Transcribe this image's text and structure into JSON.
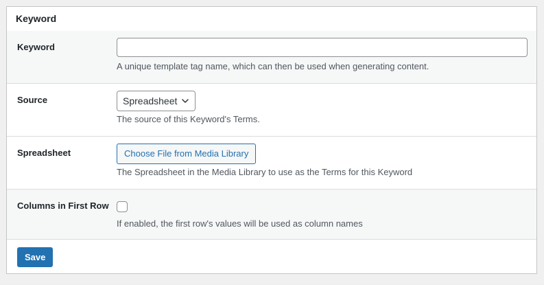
{
  "panel": {
    "title": "Keyword"
  },
  "fields": {
    "keyword": {
      "label": "Keyword",
      "value": "",
      "placeholder": "",
      "description": "A unique template tag name, which can then be used when generating content."
    },
    "source": {
      "label": "Source",
      "selected": "Spreadsheet",
      "description": "The source of this Keyword's Terms."
    },
    "spreadsheet": {
      "label": "Spreadsheet",
      "button_label": "Choose File from Media Library",
      "description": "The Spreadsheet in the Media Library to use as the Terms for this Keyword"
    },
    "columns_first_row": {
      "label": "Columns in First Row",
      "checked": false,
      "description": "If enabled, the first row's values will be used as column names"
    }
  },
  "footer": {
    "save_label": "Save"
  },
  "colors": {
    "accent": "#2271b1",
    "border": "#c3c4c7",
    "row_alt": "#f6f7f7",
    "background": "#f0f0f1"
  },
  "icons": {
    "select_chevron": "chevron-down-icon"
  }
}
